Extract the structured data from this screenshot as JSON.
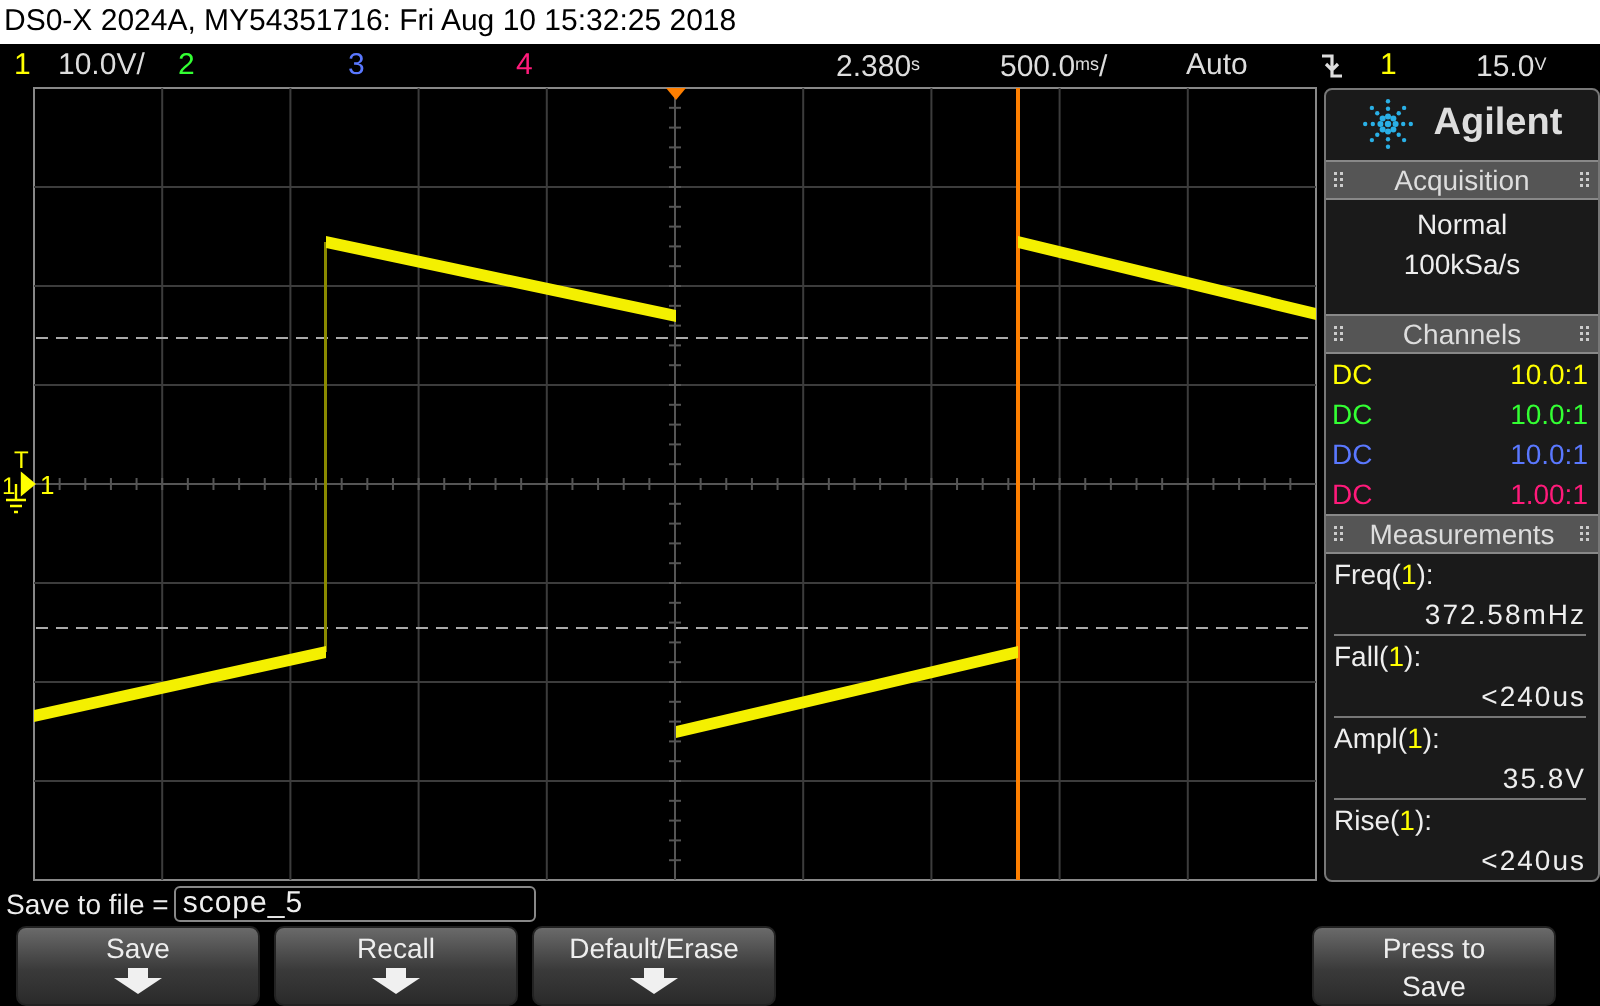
{
  "title": "DS0-X 2024A, MY54351716: Fri Aug 10 15:32:25 2018",
  "status_bar": {
    "channels": [
      {
        "number": "1",
        "scale": "10.0V/",
        "color": "#ffff00"
      },
      {
        "number": "2",
        "color": "#33ff33"
      },
      {
        "number": "3",
        "color": "#5a78ff"
      },
      {
        "number": "4",
        "color": "#ff1a7a"
      }
    ],
    "delay": {
      "value": "2.380",
      "unit": "s"
    },
    "timebase": {
      "value": "500.0",
      "unit": "ms",
      "suffix": "/"
    },
    "trigger": {
      "mode": "Auto",
      "source": "1",
      "level": "15.0",
      "unit": "V"
    }
  },
  "graticule": {
    "trigger_level_marker": "T",
    "ground_marker": "1",
    "channel_label": "1"
  },
  "panel": {
    "brand": "Agilent",
    "acquisition": {
      "title": "Acquisition",
      "mode": "Normal",
      "rate": "100kSa/s"
    },
    "channels": {
      "title": "Channels",
      "rows": [
        {
          "coupling": "DC",
          "probe": "10.0:1",
          "color": "#ffff00"
        },
        {
          "coupling": "DC",
          "probe": "10.0:1",
          "color": "#33ff33"
        },
        {
          "coupling": "DC",
          "probe": "10.0:1",
          "color": "#5a78ff"
        },
        {
          "coupling": "DC",
          "probe": "1.00:1",
          "color": "#ff1a7a"
        }
      ]
    },
    "measurements": {
      "title": "Measurements",
      "items": [
        {
          "label_start": "Freq(",
          "source": "1",
          "label_end": "):",
          "value": "372.58mHz"
        },
        {
          "label_start": "Fall(",
          "source": "1",
          "label_end": "):",
          "value": "<240us"
        },
        {
          "label_start": "Ampl(",
          "source": "1",
          "label_end": "):",
          "value": "35.8V"
        },
        {
          "label_start": "Rise(",
          "source": "1",
          "label_end": "):",
          "value": "<240us"
        }
      ]
    }
  },
  "save": {
    "label": "Save to file =",
    "value": "scope_5"
  },
  "softkeys": [
    {
      "kind": "menu",
      "label": "Save"
    },
    {
      "kind": "menu",
      "label": "Recall"
    },
    {
      "kind": "menu",
      "label": "Default/Erase"
    },
    {
      "kind": "action",
      "label": "Press to Save"
    }
  ]
}
